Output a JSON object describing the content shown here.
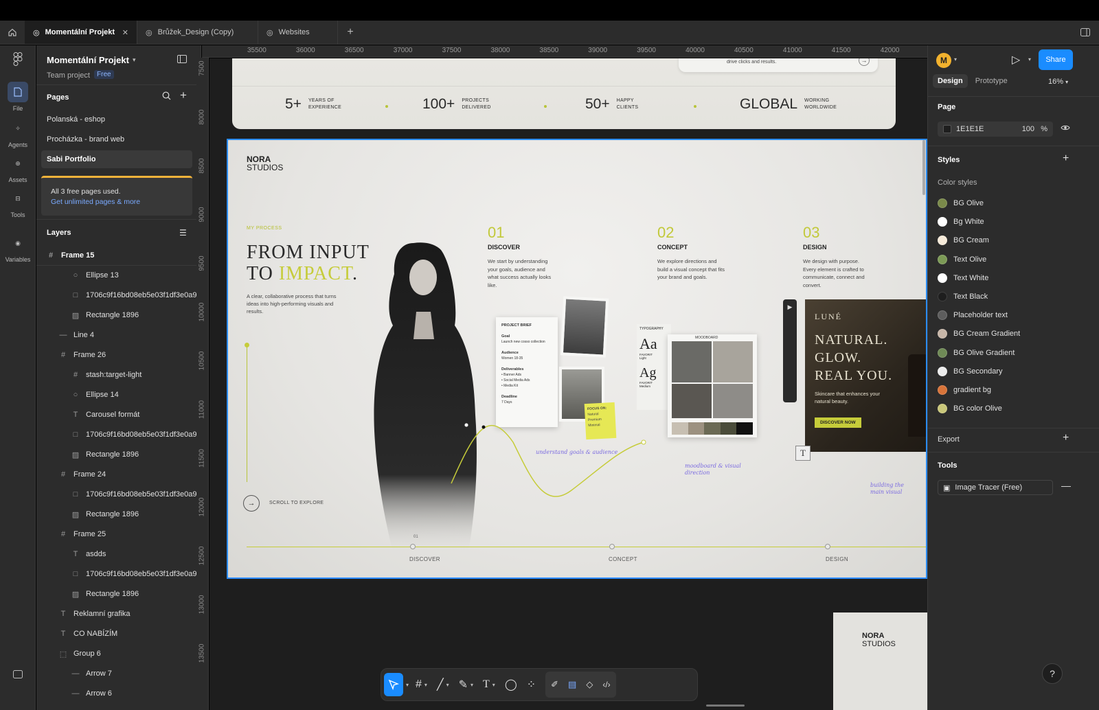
{
  "tabs": [
    {
      "label": "Momentální Projekt",
      "active": true
    },
    {
      "label": "Brůžek_Design (Copy)",
      "active": false
    },
    {
      "label": "Websites",
      "active": false
    }
  ],
  "rail": [
    {
      "label": "File",
      "icon": "file-icon"
    },
    {
      "label": "Agents",
      "icon": "agents-icon"
    },
    {
      "label": "Assets",
      "icon": "assets-icon"
    },
    {
      "label": "Tools",
      "icon": "tools-icon"
    },
    {
      "label": "Variables",
      "icon": "variables-icon"
    }
  ],
  "project": {
    "title": "Momentální Projekt",
    "subtitle": "Team project",
    "badge": "Free"
  },
  "pages": {
    "label": "Pages",
    "items": [
      "Polanská - eshop",
      "Procházka - brand web",
      "Sabi Portfolio"
    ],
    "selected_index": 2,
    "notice_text": "All 3 free pages used.",
    "notice_link": "Get unlimited pages & more"
  },
  "layers": {
    "label": "Layers",
    "items": [
      {
        "name": "Frame 15",
        "icon": "#",
        "indent": 0
      },
      {
        "name": "Ellipse 13",
        "icon": "○",
        "indent": 2
      },
      {
        "name": "1706c9f16bd08eb5e03f1df3e0a9",
        "icon": "□",
        "indent": 2
      },
      {
        "name": "Rectangle 1896",
        "icon": "▨",
        "indent": 2
      },
      {
        "name": "Line 4",
        "icon": "—",
        "indent": 1
      },
      {
        "name": "Frame 26",
        "icon": "#",
        "indent": 1
      },
      {
        "name": "stash:target-light",
        "icon": "#",
        "indent": 2
      },
      {
        "name": "Ellipse 14",
        "icon": "○",
        "indent": 2
      },
      {
        "name": "Carousel formát",
        "icon": "T",
        "indent": 2
      },
      {
        "name": "1706c9f16bd08eb5e03f1df3e0a9",
        "icon": "□",
        "indent": 2
      },
      {
        "name": "Rectangle 1896",
        "icon": "▨",
        "indent": 2
      },
      {
        "name": "Frame 24",
        "icon": "#",
        "indent": 1
      },
      {
        "name": "1706c9f16bd08eb5e03f1df3e0a9",
        "icon": "□",
        "indent": 2
      },
      {
        "name": "Rectangle 1896",
        "icon": "▨",
        "indent": 2
      },
      {
        "name": "Frame 25",
        "icon": "#",
        "indent": 1
      },
      {
        "name": "asdds",
        "icon": "T",
        "indent": 2
      },
      {
        "name": "1706c9f16bd08eb5e03f1df3e0a9",
        "icon": "□",
        "indent": 2
      },
      {
        "name": "Rectangle 1896",
        "icon": "▨",
        "indent": 2
      },
      {
        "name": "Reklamní grafika",
        "icon": "T",
        "indent": 1
      },
      {
        "name": "CO NABÍZÍM",
        "icon": "T",
        "indent": 1
      },
      {
        "name": "Group 6",
        "icon": "⬚",
        "indent": 1
      },
      {
        "name": "Arrow 7",
        "icon": "—",
        "indent": 2
      },
      {
        "name": "Arrow 6",
        "icon": "—",
        "indent": 2
      }
    ]
  },
  "ruler_top": [
    "35500",
    "36000",
    "36500",
    "37000",
    "37500",
    "38000",
    "38500",
    "39000",
    "39500",
    "40000",
    "40500",
    "41000",
    "41500",
    "42000"
  ],
  "ruler_left": [
    "7500",
    "8000",
    "8500",
    "9000",
    "9500",
    "10000",
    "10500",
    "11000",
    "11500",
    "12000",
    "12500",
    "13000",
    "13500"
  ],
  "canvas": {
    "stats_top_text": "drive clicks and results.",
    "stats": [
      {
        "num": "5+",
        "label1": "YEARS OF",
        "label2": "EXPERIENCE"
      },
      {
        "num": "100+",
        "label1": "PROJECTS",
        "label2": "DELIVERED"
      },
      {
        "num": "50+",
        "label1": "HAPPY",
        "label2": "CLIENTS"
      },
      {
        "num": "GLOBAL",
        "label1": "WORKING",
        "label2": "WORLDWIDE"
      }
    ],
    "brand_1": "NORA",
    "brand_2": "STUDIOS",
    "eyebrow": "MY PROCESS",
    "headline_1": "FROM INPUT",
    "headline_2a": "TO ",
    "headline_2b": "IMPACT",
    "headline_2c": ".",
    "description": "A clear, collaborative process that turns ideas into high-performing visuals and results.",
    "steps": [
      {
        "n": "01",
        "title": "DISCOVER",
        "desc": "We start by understanding your goals, audience and what success actually looks like."
      },
      {
        "n": "02",
        "title": "CONCEPT",
        "desc": "We explore directions and build a visual concept that fits your brand and goals."
      },
      {
        "n": "03",
        "title": "DESIGN",
        "desc": "We design with purpose. Every element is crafted to communicate, connect and convert."
      }
    ],
    "brief": {
      "title": "PROJECT BRIEF",
      "goal_label": "Goal",
      "goal": "Launch new cosso collection",
      "audience_label": "Audience",
      "audience": "Women 18-35",
      "deliverables_label": "Deliverables",
      "deliverables": [
        "• Banner Ads",
        "• Social Media Ads",
        "• Media Kit"
      ],
      "deadline_label": "Deadline",
      "deadline": "7 Days"
    },
    "sticky": {
      "title": "FOCUS ON:",
      "items": [
        "Natural",
        "Premium",
        "Minimal"
      ]
    },
    "typography": {
      "label": "TYPOGRAPHY",
      "aa": "Aa",
      "aa_sub1": "FAVORIT",
      "aa_sub2": "Light",
      "ag": "Ag",
      "ag_sub1": "FAVORIT",
      "ag_sub2": "Medium"
    },
    "moodboard_label": "MOODBOARD",
    "hand_1": "understand goals & audience",
    "hand_2": "moodboard & visual direction",
    "hand_3": "building the main visual",
    "product": {
      "brand": "LUNÉ",
      "line1": "NATURAL.",
      "line2": "GLOW.",
      "line3": "REAL YOU.",
      "desc": "Skincare that enhances your natural beauty.",
      "cta": "DISCOVER NOW"
    },
    "scroll_label": "SCROLL TO EXPLORE",
    "timeline": [
      "DISCOVER",
      "CONCEPT",
      "DESIGN"
    ],
    "timeline_marker": "01",
    "mini_brand_1": "NORA",
    "mini_brand_2": "STUDIOS"
  },
  "toolbar": {
    "tools": [
      "move-tool",
      "frame-tool",
      "pen-line-tool",
      "shape-tool",
      "text-tool",
      "comment-tool",
      "components-tool",
      "draw-tool",
      "layout-tool",
      "component-tool",
      "dev-mode-tool"
    ]
  },
  "right": {
    "avatar": "M",
    "share_label": "Share",
    "tabs": [
      "Design",
      "Prototype"
    ],
    "zoom": "16%",
    "page_label": "Page",
    "page_color": "1E1E1E",
    "page_opacity": "100",
    "page_opacity_unit": "%",
    "styles_label": "Styles",
    "color_styles_label": "Color styles",
    "colors": [
      {
        "name": "BG Olive",
        "color": "#7a8a4a"
      },
      {
        "name": "Bg White",
        "color": "#ffffff"
      },
      {
        "name": "BG Cream",
        "color": "#f6ead9"
      },
      {
        "name": "Text Olive",
        "color": "#7c9a56"
      },
      {
        "name": "Text White",
        "color": "#ffffff"
      },
      {
        "name": "Text Black",
        "color": "#1e1e1e"
      },
      {
        "name": "Placeholder text",
        "color": "#5e5e5e"
      },
      {
        "name": "BG Cream Gradient",
        "color": "#c7b6a8"
      },
      {
        "name": "BG Olive Gradient",
        "color": "#6f8a56"
      },
      {
        "name": "BG Secondary",
        "color": "#ececec"
      },
      {
        "name": "gradient bg",
        "color": "#d8743a"
      },
      {
        "name": "BG color Olive",
        "color": "#c9c77a"
      }
    ],
    "export_label": "Export",
    "tools_label": "Tools",
    "tool_item": "Image Tracer (Free)",
    "help": "?"
  }
}
